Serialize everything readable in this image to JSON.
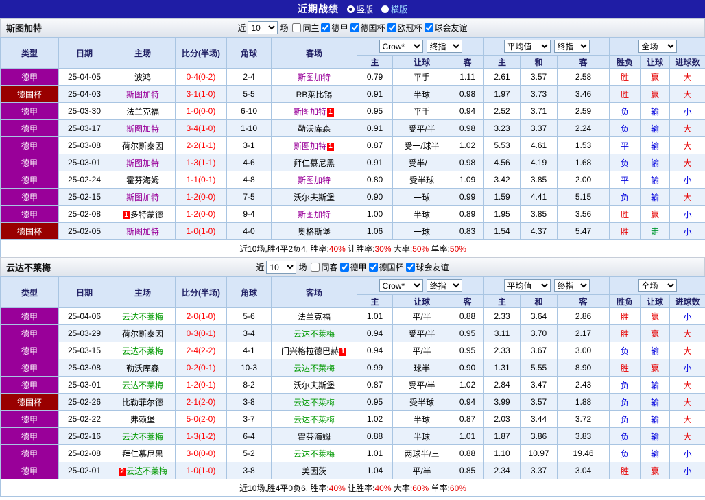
{
  "topbar": {
    "title": "近期战绩",
    "vertical": "竖版",
    "horizontal": "横版",
    "selected": "竖版"
  },
  "labels": {
    "near": "近",
    "matches": "场"
  },
  "columns": {
    "type": "类型",
    "date": "日期",
    "home": "主场",
    "score": "比分(半场)",
    "corner": "角球",
    "away": "客场",
    "bookmaker": "Crow*",
    "final_odds": "终指",
    "average": "平均值",
    "full_match": "全场",
    "sub": [
      "主",
      "让球",
      "客",
      "主",
      "和",
      "客",
      "胜负",
      "让球",
      "进球数"
    ]
  },
  "palette": {
    "league": {
      "德甲": "#990099",
      "德国杯": "#990000"
    },
    "score": "#ff0000",
    "badge": "#ff0000",
    "result": {
      "胜": "#e60000",
      "负": "#0000dd",
      "平": "#0000dd",
      "赢": "#e60000",
      "输": "#0000dd",
      "走": "#009933",
      "大": "#e60000",
      "小": "#0000dd"
    }
  },
  "sections": [
    {
      "team": "斯图加特",
      "highlight": "#990099",
      "filter": {
        "count": "10",
        "checkboxes": [
          {
            "label": "同主",
            "checked": false
          },
          {
            "label": "德甲",
            "checked": true
          },
          {
            "label": "德国杯",
            "checked": true
          },
          {
            "label": "欧冠杯",
            "checked": true
          },
          {
            "label": "球会友谊",
            "checked": true
          }
        ]
      },
      "rows": [
        {
          "league": "德甲",
          "date": "25-04-05",
          "home": {
            "name": "波鸿"
          },
          "score": "0-4(0-2)",
          "corner": "2-4",
          "away": {
            "name": "斯图加特",
            "hl": true
          },
          "odds": [
            "0.79",
            "平手",
            "1.11",
            "2.61",
            "3.57",
            "2.58"
          ],
          "results": [
            "胜",
            "赢",
            "大"
          ]
        },
        {
          "league": "德国杯",
          "date": "25-04-03",
          "home": {
            "name": "斯图加特",
            "hl": true
          },
          "score": "3-1(1-0)",
          "corner": "5-5",
          "away": {
            "name": "RB莱比锡"
          },
          "odds": [
            "0.91",
            "半球",
            "0.98",
            "1.97",
            "3.73",
            "3.46"
          ],
          "results": [
            "胜",
            "赢",
            "大"
          ]
        },
        {
          "league": "德甲",
          "date": "25-03-30",
          "home": {
            "name": "法兰克福"
          },
          "score": "1-0(0-0)",
          "corner": "6-10",
          "away": {
            "name": "斯图加特",
            "hl": true,
            "badge": "1",
            "badge_pos": "after"
          },
          "odds": [
            "0.95",
            "平手",
            "0.94",
            "2.52",
            "3.71",
            "2.59"
          ],
          "results": [
            "负",
            "输",
            "小"
          ]
        },
        {
          "league": "德甲",
          "date": "25-03-17",
          "home": {
            "name": "斯图加特",
            "hl": true
          },
          "score": "3-4(1-0)",
          "corner": "1-10",
          "away": {
            "name": "勒沃库森"
          },
          "odds": [
            "0.91",
            "受平/半",
            "0.98",
            "3.23",
            "3.37",
            "2.24"
          ],
          "results": [
            "负",
            "输",
            "大"
          ]
        },
        {
          "league": "德甲",
          "date": "25-03-08",
          "home": {
            "name": "荷尔斯泰因"
          },
          "score": "2-2(1-1)",
          "corner": "3-1",
          "away": {
            "name": "斯图加特",
            "hl": true,
            "badge": "1",
            "badge_pos": "after"
          },
          "odds": [
            "0.87",
            "受一/球半",
            "1.02",
            "5.53",
            "4.61",
            "1.53"
          ],
          "results": [
            "平",
            "输",
            "大"
          ]
        },
        {
          "league": "德甲",
          "date": "25-03-01",
          "home": {
            "name": "斯图加特",
            "hl": true
          },
          "score": "1-3(1-1)",
          "corner": "4-6",
          "away": {
            "name": "拜仁慕尼黑"
          },
          "odds": [
            "0.91",
            "受半/一",
            "0.98",
            "4.56",
            "4.19",
            "1.68"
          ],
          "results": [
            "负",
            "输",
            "大"
          ]
        },
        {
          "league": "德甲",
          "date": "25-02-24",
          "home": {
            "name": "霍芬海姆"
          },
          "score": "1-1(0-1)",
          "corner": "4-8",
          "away": {
            "name": "斯图加特",
            "hl": true
          },
          "odds": [
            "0.80",
            "受半球",
            "1.09",
            "3.42",
            "3.85",
            "2.00"
          ],
          "results": [
            "平",
            "输",
            "小"
          ]
        },
        {
          "league": "德甲",
          "date": "25-02-15",
          "home": {
            "name": "斯图加特",
            "hl": true
          },
          "score": "1-2(0-0)",
          "corner": "7-5",
          "away": {
            "name": "沃尔夫斯堡"
          },
          "odds": [
            "0.90",
            "一球",
            "0.99",
            "1.59",
            "4.41",
            "5.15"
          ],
          "results": [
            "负",
            "输",
            "大"
          ]
        },
        {
          "league": "德甲",
          "date": "25-02-08",
          "home": {
            "name": "多特蒙德",
            "badge": "1",
            "badge_pos": "before"
          },
          "score": "1-2(0-0)",
          "corner": "9-4",
          "away": {
            "name": "斯图加特",
            "hl": true
          },
          "odds": [
            "1.00",
            "半球",
            "0.89",
            "1.95",
            "3.85",
            "3.56"
          ],
          "results": [
            "胜",
            "赢",
            "小"
          ]
        },
        {
          "league": "德国杯",
          "date": "25-02-05",
          "home": {
            "name": "斯图加特",
            "hl": true
          },
          "score": "1-0(1-0)",
          "corner": "4-0",
          "away": {
            "name": "奥格斯堡"
          },
          "odds": [
            "1.06",
            "一球",
            "0.83",
            "1.54",
            "4.37",
            "5.47"
          ],
          "results": [
            "胜",
            "走",
            "小"
          ]
        }
      ],
      "summary": {
        "prefix": "近10场,胜4平2负4,",
        "stats": [
          {
            "label": "胜率:",
            "value": "40%"
          },
          {
            "label": "让胜率:",
            "value": "30%"
          },
          {
            "label": "大率:",
            "value": "50%"
          },
          {
            "label": "单率:",
            "value": "50%"
          }
        ]
      }
    },
    {
      "team": "云达不莱梅",
      "highlight": "#009900",
      "filter": {
        "count": "10",
        "checkboxes": [
          {
            "label": "同客",
            "checked": false
          },
          {
            "label": "德甲",
            "checked": true
          },
          {
            "label": "德国杯",
            "checked": true
          },
          {
            "label": "球会友谊",
            "checked": true
          }
        ]
      },
      "rows": [
        {
          "league": "德甲",
          "date": "25-04-06",
          "home": {
            "name": "云达不莱梅",
            "hl": true
          },
          "score": "2-0(1-0)",
          "corner": "5-6",
          "away": {
            "name": "法兰克福"
          },
          "odds": [
            "1.01",
            "平/半",
            "0.88",
            "2.33",
            "3.64",
            "2.86"
          ],
          "results": [
            "胜",
            "赢",
            "小"
          ]
        },
        {
          "league": "德甲",
          "date": "25-03-29",
          "home": {
            "name": "荷尔斯泰因"
          },
          "score": "0-3(0-1)",
          "corner": "3-4",
          "away": {
            "name": "云达不莱梅",
            "hl": true
          },
          "odds": [
            "0.94",
            "受平/半",
            "0.95",
            "3.11",
            "3.70",
            "2.17"
          ],
          "results": [
            "胜",
            "赢",
            "大"
          ]
        },
        {
          "league": "德甲",
          "date": "25-03-15",
          "home": {
            "name": "云达不莱梅",
            "hl": true
          },
          "score": "2-4(2-2)",
          "corner": "4-1",
          "away": {
            "name": "门兴格拉德巴赫",
            "badge": "1",
            "badge_pos": "after"
          },
          "odds": [
            "0.94",
            "平/半",
            "0.95",
            "2.33",
            "3.67",
            "3.00"
          ],
          "results": [
            "负",
            "输",
            "大"
          ]
        },
        {
          "league": "德甲",
          "date": "25-03-08",
          "home": {
            "name": "勒沃库森"
          },
          "score": "0-2(0-1)",
          "corner": "10-3",
          "away": {
            "name": "云达不莱梅",
            "hl": true
          },
          "odds": [
            "0.99",
            "球半",
            "0.90",
            "1.31",
            "5.55",
            "8.90"
          ],
          "results": [
            "胜",
            "赢",
            "小"
          ]
        },
        {
          "league": "德甲",
          "date": "25-03-01",
          "home": {
            "name": "云达不莱梅",
            "hl": true
          },
          "score": "1-2(0-1)",
          "corner": "8-2",
          "away": {
            "name": "沃尔夫斯堡"
          },
          "odds": [
            "0.87",
            "受平/半",
            "1.02",
            "2.84",
            "3.47",
            "2.43"
          ],
          "results": [
            "负",
            "输",
            "大"
          ]
        },
        {
          "league": "德国杯",
          "date": "25-02-26",
          "home": {
            "name": "比勒菲尔德"
          },
          "score": "2-1(2-0)",
          "corner": "3-8",
          "away": {
            "name": "云达不莱梅",
            "hl": true
          },
          "odds": [
            "0.95",
            "受半球",
            "0.94",
            "3.99",
            "3.57",
            "1.88"
          ],
          "results": [
            "负",
            "输",
            "大"
          ]
        },
        {
          "league": "德甲",
          "date": "25-02-22",
          "home": {
            "name": "弗赖堡"
          },
          "score": "5-0(2-0)",
          "corner": "3-7",
          "away": {
            "name": "云达不莱梅",
            "hl": true
          },
          "odds": [
            "1.02",
            "半球",
            "0.87",
            "2.03",
            "3.44",
            "3.72"
          ],
          "results": [
            "负",
            "输",
            "大"
          ]
        },
        {
          "league": "德甲",
          "date": "25-02-16",
          "home": {
            "name": "云达不莱梅",
            "hl": true
          },
          "score": "1-3(1-2)",
          "corner": "6-4",
          "away": {
            "name": "霍芬海姆"
          },
          "odds": [
            "0.88",
            "半球",
            "1.01",
            "1.87",
            "3.86",
            "3.83"
          ],
          "results": [
            "负",
            "输",
            "大"
          ]
        },
        {
          "league": "德甲",
          "date": "25-02-08",
          "home": {
            "name": "拜仁慕尼黑"
          },
          "score": "3-0(0-0)",
          "corner": "5-2",
          "away": {
            "name": "云达不莱梅",
            "hl": true
          },
          "odds": [
            "1.01",
            "两球半/三",
            "0.88",
            "1.10",
            "10.97",
            "19.46"
          ],
          "results": [
            "负",
            "输",
            "小"
          ]
        },
        {
          "league": "德甲",
          "date": "25-02-01",
          "home": {
            "name": "云达不莱梅",
            "hl": true,
            "badge": "2",
            "badge_pos": "before"
          },
          "score": "1-0(1-0)",
          "corner": "3-8",
          "away": {
            "name": "美因茨"
          },
          "odds": [
            "1.04",
            "平/半",
            "0.85",
            "2.34",
            "3.37",
            "3.04"
          ],
          "results": [
            "胜",
            "赢",
            "小"
          ]
        }
      ],
      "summary": {
        "prefix": "近10场,胜4平0负6,",
        "stats": [
          {
            "label": "胜率:",
            "value": "40%"
          },
          {
            "label": "让胜率:",
            "value": "40%"
          },
          {
            "label": "大率:",
            "value": "60%"
          },
          {
            "label": "单率:",
            "value": "60%"
          }
        ]
      }
    }
  ]
}
